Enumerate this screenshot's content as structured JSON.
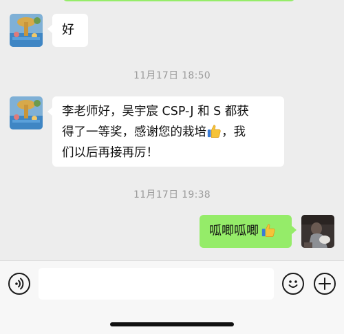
{
  "messages": [
    {
      "from": "them",
      "text": "好"
    },
    {
      "time": "11月17日 18:50"
    },
    {
      "from": "them",
      "line1": "李老师好，吴宇宸 CSP-J 和 S 都获",
      "line2_before": "得了一等奖，感谢您的栽培",
      "line2_after": "，我",
      "line3": "们以后再接再厉！"
    },
    {
      "time": "11月17日 19:38"
    },
    {
      "from": "me",
      "text": "呱唧呱唧"
    }
  ],
  "icons": {
    "voice": "voice-icon",
    "emoji": "emoji-icon",
    "plus": "plus-icon",
    "thumbs_up": "thumbs-up-emoji"
  },
  "colors": {
    "background": "#ededed",
    "incoming_bubble": "#ffffff",
    "outgoing_bubble": "#95ec69",
    "timestamp_text": "#9b9b9b"
  }
}
